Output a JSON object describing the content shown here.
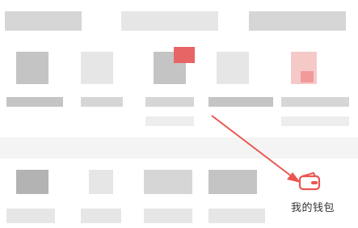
{
  "menu": {
    "wallet": {
      "label": "我的钱包",
      "icon": "wallet-icon",
      "accent_color": "#e9564f"
    }
  }
}
